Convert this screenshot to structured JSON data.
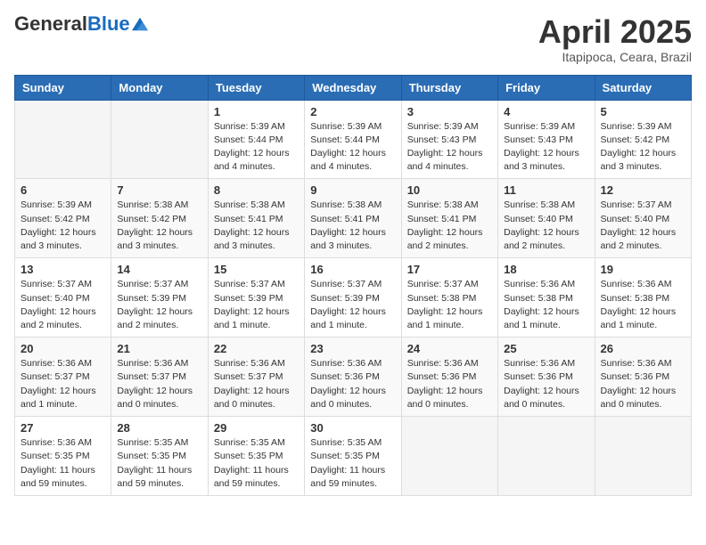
{
  "header": {
    "logo_general": "General",
    "logo_blue": "Blue",
    "month_title": "April 2025",
    "location": "Itapipoca, Ceara, Brazil"
  },
  "weekdays": [
    "Sunday",
    "Monday",
    "Tuesday",
    "Wednesday",
    "Thursday",
    "Friday",
    "Saturday"
  ],
  "weeks": [
    [
      {
        "day": "",
        "info": ""
      },
      {
        "day": "",
        "info": ""
      },
      {
        "day": "1",
        "info": "Sunrise: 5:39 AM\nSunset: 5:44 PM\nDaylight: 12 hours and 4 minutes."
      },
      {
        "day": "2",
        "info": "Sunrise: 5:39 AM\nSunset: 5:44 PM\nDaylight: 12 hours and 4 minutes."
      },
      {
        "day": "3",
        "info": "Sunrise: 5:39 AM\nSunset: 5:43 PM\nDaylight: 12 hours and 4 minutes."
      },
      {
        "day": "4",
        "info": "Sunrise: 5:39 AM\nSunset: 5:43 PM\nDaylight: 12 hours and 3 minutes."
      },
      {
        "day": "5",
        "info": "Sunrise: 5:39 AM\nSunset: 5:42 PM\nDaylight: 12 hours and 3 minutes."
      }
    ],
    [
      {
        "day": "6",
        "info": "Sunrise: 5:39 AM\nSunset: 5:42 PM\nDaylight: 12 hours and 3 minutes."
      },
      {
        "day": "7",
        "info": "Sunrise: 5:38 AM\nSunset: 5:42 PM\nDaylight: 12 hours and 3 minutes."
      },
      {
        "day": "8",
        "info": "Sunrise: 5:38 AM\nSunset: 5:41 PM\nDaylight: 12 hours and 3 minutes."
      },
      {
        "day": "9",
        "info": "Sunrise: 5:38 AM\nSunset: 5:41 PM\nDaylight: 12 hours and 3 minutes."
      },
      {
        "day": "10",
        "info": "Sunrise: 5:38 AM\nSunset: 5:41 PM\nDaylight: 12 hours and 2 minutes."
      },
      {
        "day": "11",
        "info": "Sunrise: 5:38 AM\nSunset: 5:40 PM\nDaylight: 12 hours and 2 minutes."
      },
      {
        "day": "12",
        "info": "Sunrise: 5:37 AM\nSunset: 5:40 PM\nDaylight: 12 hours and 2 minutes."
      }
    ],
    [
      {
        "day": "13",
        "info": "Sunrise: 5:37 AM\nSunset: 5:40 PM\nDaylight: 12 hours and 2 minutes."
      },
      {
        "day": "14",
        "info": "Sunrise: 5:37 AM\nSunset: 5:39 PM\nDaylight: 12 hours and 2 minutes."
      },
      {
        "day": "15",
        "info": "Sunrise: 5:37 AM\nSunset: 5:39 PM\nDaylight: 12 hours and 1 minute."
      },
      {
        "day": "16",
        "info": "Sunrise: 5:37 AM\nSunset: 5:39 PM\nDaylight: 12 hours and 1 minute."
      },
      {
        "day": "17",
        "info": "Sunrise: 5:37 AM\nSunset: 5:38 PM\nDaylight: 12 hours and 1 minute."
      },
      {
        "day": "18",
        "info": "Sunrise: 5:36 AM\nSunset: 5:38 PM\nDaylight: 12 hours and 1 minute."
      },
      {
        "day": "19",
        "info": "Sunrise: 5:36 AM\nSunset: 5:38 PM\nDaylight: 12 hours and 1 minute."
      }
    ],
    [
      {
        "day": "20",
        "info": "Sunrise: 5:36 AM\nSunset: 5:37 PM\nDaylight: 12 hours and 1 minute."
      },
      {
        "day": "21",
        "info": "Sunrise: 5:36 AM\nSunset: 5:37 PM\nDaylight: 12 hours and 0 minutes."
      },
      {
        "day": "22",
        "info": "Sunrise: 5:36 AM\nSunset: 5:37 PM\nDaylight: 12 hours and 0 minutes."
      },
      {
        "day": "23",
        "info": "Sunrise: 5:36 AM\nSunset: 5:36 PM\nDaylight: 12 hours and 0 minutes."
      },
      {
        "day": "24",
        "info": "Sunrise: 5:36 AM\nSunset: 5:36 PM\nDaylight: 12 hours and 0 minutes."
      },
      {
        "day": "25",
        "info": "Sunrise: 5:36 AM\nSunset: 5:36 PM\nDaylight: 12 hours and 0 minutes."
      },
      {
        "day": "26",
        "info": "Sunrise: 5:36 AM\nSunset: 5:36 PM\nDaylight: 12 hours and 0 minutes."
      }
    ],
    [
      {
        "day": "27",
        "info": "Sunrise: 5:36 AM\nSunset: 5:35 PM\nDaylight: 11 hours and 59 minutes."
      },
      {
        "day": "28",
        "info": "Sunrise: 5:35 AM\nSunset: 5:35 PM\nDaylight: 11 hours and 59 minutes."
      },
      {
        "day": "29",
        "info": "Sunrise: 5:35 AM\nSunset: 5:35 PM\nDaylight: 11 hours and 59 minutes."
      },
      {
        "day": "30",
        "info": "Sunrise: 5:35 AM\nSunset: 5:35 PM\nDaylight: 11 hours and 59 minutes."
      },
      {
        "day": "",
        "info": ""
      },
      {
        "day": "",
        "info": ""
      },
      {
        "day": "",
        "info": ""
      }
    ]
  ]
}
